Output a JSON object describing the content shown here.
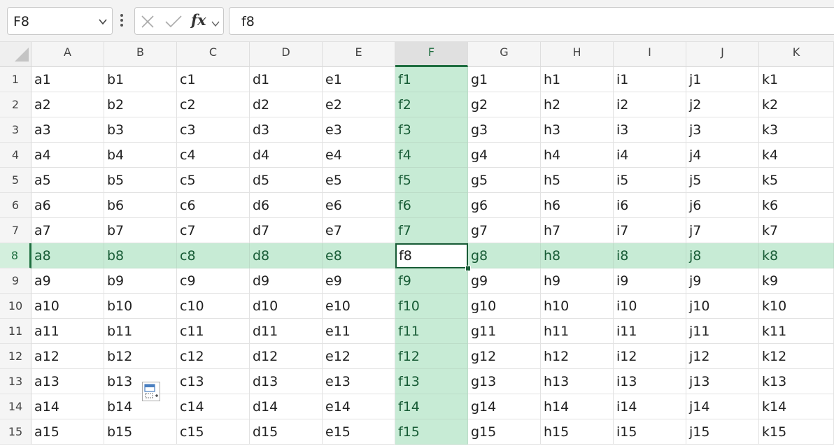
{
  "name_box": {
    "value": "F8"
  },
  "formula_bar": {
    "dots_icon": "more-options-icon",
    "cancel_icon": "cancel-x-icon",
    "enter_icon": "enter-checkmark-icon",
    "fx_label": "fx",
    "value": "f8"
  },
  "active_cell": "F8",
  "columns": [
    "A",
    "B",
    "C",
    "D",
    "E",
    "F",
    "G",
    "H",
    "I",
    "J",
    "K"
  ],
  "rows": [
    {
      "num": "1",
      "cells": [
        "a1",
        "b1",
        "c1",
        "d1",
        "e1",
        "f1",
        "g1",
        "h1",
        "i1",
        "j1",
        "k1"
      ]
    },
    {
      "num": "2",
      "cells": [
        "a2",
        "b2",
        "c2",
        "d2",
        "e2",
        "f2",
        "g2",
        "h2",
        "i2",
        "j2",
        "k2"
      ]
    },
    {
      "num": "3",
      "cells": [
        "a3",
        "b3",
        "c3",
        "d3",
        "e3",
        "f3",
        "g3",
        "h3",
        "i3",
        "j3",
        "k3"
      ]
    },
    {
      "num": "4",
      "cells": [
        "a4",
        "b4",
        "c4",
        "d4",
        "e4",
        "f4",
        "g4",
        "h4",
        "i4",
        "j4",
        "k4"
      ]
    },
    {
      "num": "5",
      "cells": [
        "a5",
        "b5",
        "c5",
        "d5",
        "e5",
        "f5",
        "g5",
        "h5",
        "i5",
        "j5",
        "k5"
      ]
    },
    {
      "num": "6",
      "cells": [
        "a6",
        "b6",
        "c6",
        "d6",
        "e6",
        "f6",
        "g6",
        "h6",
        "i6",
        "j6",
        "k6"
      ]
    },
    {
      "num": "7",
      "cells": [
        "a7",
        "b7",
        "c7",
        "d7",
        "e7",
        "f7",
        "g7",
        "h7",
        "i7",
        "j7",
        "k7"
      ]
    },
    {
      "num": "8",
      "cells": [
        "a8",
        "b8",
        "c8",
        "d8",
        "e8",
        "f8",
        "g8",
        "h8",
        "i8",
        "j8",
        "k8"
      ]
    },
    {
      "num": "9",
      "cells": [
        "a9",
        "b9",
        "c9",
        "d9",
        "e9",
        "f9",
        "g9",
        "h9",
        "i9",
        "j9",
        "k9"
      ]
    },
    {
      "num": "10",
      "cells": [
        "a10",
        "b10",
        "c10",
        "d10",
        "e10",
        "f10",
        "g10",
        "h10",
        "i10",
        "j10",
        "k10"
      ]
    },
    {
      "num": "11",
      "cells": [
        "a11",
        "b11",
        "c11",
        "d11",
        "e11",
        "f11",
        "g11",
        "h11",
        "i11",
        "j11",
        "k11"
      ]
    },
    {
      "num": "12",
      "cells": [
        "a12",
        "b12",
        "c12",
        "d12",
        "e12",
        "f12",
        "g12",
        "h12",
        "i12",
        "j12",
        "k12"
      ]
    },
    {
      "num": "13",
      "cells": [
        "a13",
        "b13",
        "c13",
        "d13",
        "e13",
        "f13",
        "g13",
        "h13",
        "i13",
        "j13",
        "k13"
      ]
    },
    {
      "num": "14",
      "cells": [
        "a14",
        "b14",
        "c14",
        "d14",
        "e14",
        "f14",
        "g14",
        "h14",
        "i14",
        "j14",
        "k14"
      ]
    },
    {
      "num": "15",
      "cells": [
        "a15",
        "b15",
        "c15",
        "d15",
        "e15",
        "f15",
        "g15",
        "h15",
        "i15",
        "j15",
        "k15"
      ]
    }
  ],
  "colors": {
    "accent": "#1e6d3f",
    "selection_fill": "#c7ebd5"
  },
  "paste_options_icon": "paste-options-icon"
}
